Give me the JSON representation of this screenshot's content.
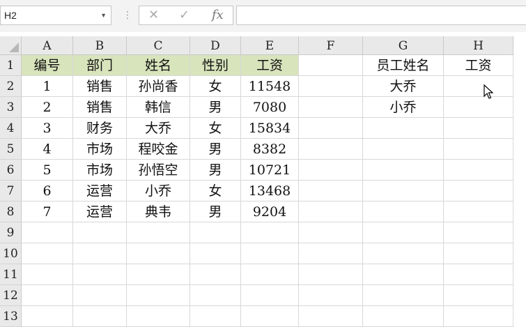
{
  "formula_bar": {
    "name_box": "H2",
    "cancel_icon": "✕",
    "enter_icon": "✓",
    "fx_label": "fx",
    "formula_value": ""
  },
  "columns": [
    "A",
    "B",
    "C",
    "D",
    "E",
    "F",
    "G",
    "H"
  ],
  "rows": [
    "1",
    "2",
    "3",
    "4",
    "5",
    "6",
    "7",
    "8",
    "9",
    "10",
    "11",
    "12",
    "13"
  ],
  "table": {
    "headers": [
      "编号",
      "部门",
      "姓名",
      "性别",
      "工资"
    ],
    "rows": [
      [
        "1",
        "销售",
        "孙尚香",
        "女",
        "11548"
      ],
      [
        "2",
        "销售",
        "韩信",
        "男",
        "7080"
      ],
      [
        "3",
        "财务",
        "大乔",
        "女",
        "15834"
      ],
      [
        "4",
        "市场",
        "程咬金",
        "男",
        "8382"
      ],
      [
        "5",
        "市场",
        "孙悟空",
        "男",
        "10721"
      ],
      [
        "6",
        "运营",
        "小乔",
        "女",
        "13468"
      ],
      [
        "7",
        "运营",
        "典韦",
        "男",
        "9204"
      ]
    ]
  },
  "lookup": {
    "headers": [
      "员工姓名",
      "工资"
    ],
    "names": [
      "大乔",
      "小乔"
    ]
  },
  "colors": {
    "header_fill": "#d8e4bc"
  }
}
